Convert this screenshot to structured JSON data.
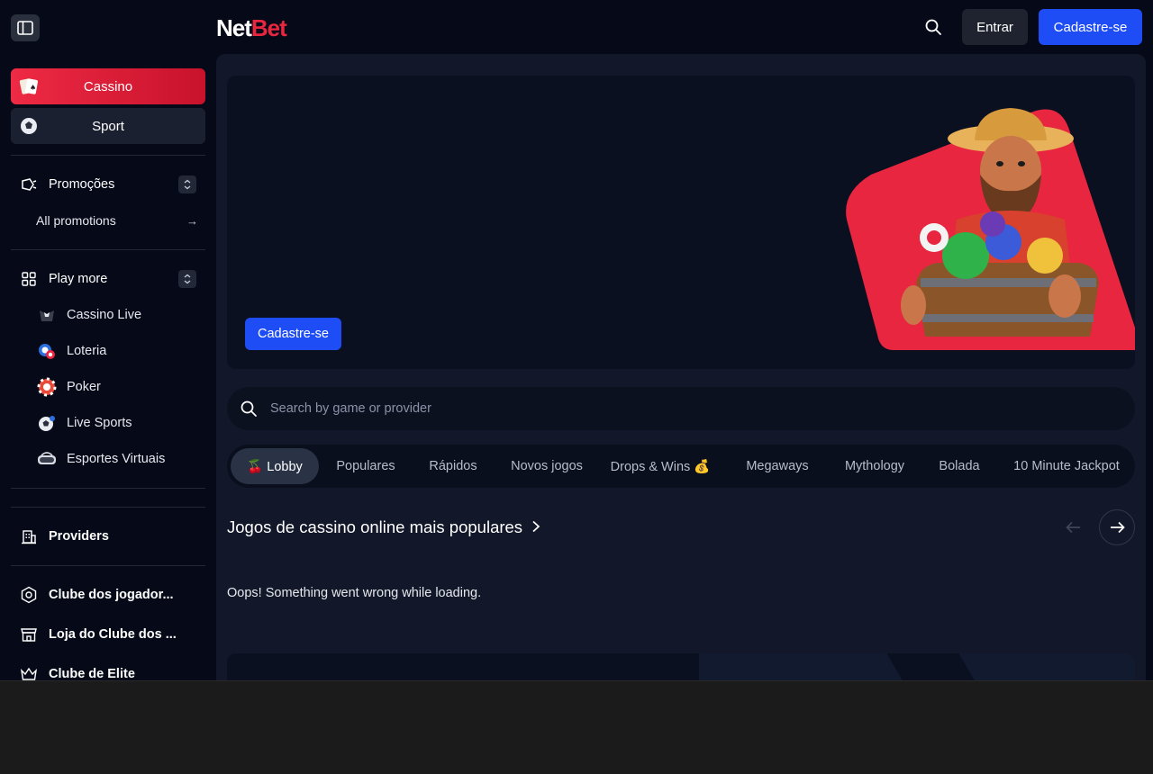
{
  "header": {
    "logo_net": "Net",
    "logo_bet": "Bet",
    "login_label": "Entrar",
    "signup_label": "Cadastre-se"
  },
  "sidebar": {
    "primary": [
      {
        "label": "Cassino",
        "icon": "playing-cards-icon"
      },
      {
        "label": "Sport",
        "icon": "soccer-ball-icon"
      }
    ],
    "promotions": {
      "label": "Promoções",
      "icon": "megaphone-icon",
      "sub_label": "All promotions"
    },
    "play_more": {
      "label": "Play more",
      "icon": "grid-icon",
      "items": [
        {
          "label": "Cassino Live",
          "icon": "dealer-icon"
        },
        {
          "label": "Loteria",
          "icon": "lottery-ball-icon"
        },
        {
          "label": "Poker",
          "icon": "poker-chip-icon"
        },
        {
          "label": "Live Sports",
          "icon": "live-ball-icon"
        },
        {
          "label": "Esportes Virtuais",
          "icon": "vr-headset-icon"
        }
      ]
    },
    "providers": {
      "label": "Providers",
      "icon": "building-icon"
    },
    "club": [
      {
        "label": "Clube dos jogador...",
        "icon": "badge-icon"
      },
      {
        "label": "Loja do Clube dos ...",
        "icon": "store-icon"
      },
      {
        "label": "Clube de Elite",
        "icon": "crown-icon"
      }
    ]
  },
  "hero": {
    "button_label": "Cadastre-se"
  },
  "search": {
    "placeholder": "Search by game or provider"
  },
  "tabs": [
    {
      "label": "🍒 Lobby",
      "active": true
    },
    {
      "label": "Populares"
    },
    {
      "label": "Rápidos"
    },
    {
      "label": "Novos jogos"
    },
    {
      "label": "Drops & Wins 💰"
    },
    {
      "label": "Megaways"
    },
    {
      "label": "Mythology"
    },
    {
      "label": "Bolada"
    },
    {
      "label": "10 Minute Jackpot"
    }
  ],
  "section": {
    "title": "Jogos de cassino online mais populares",
    "error": "Oops! Something went wrong while loading."
  },
  "colors": {
    "brand_red": "#e8263f",
    "primary_blue": "#1f4df5",
    "background": "#060a18"
  }
}
